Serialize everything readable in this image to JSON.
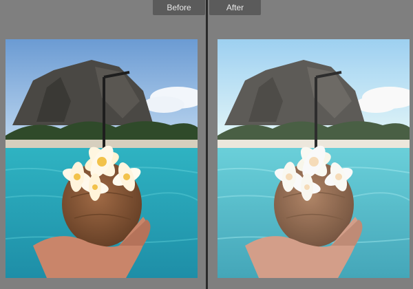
{
  "app": {
    "mode": "before-after-compare"
  },
  "panes": {
    "before": {
      "label": "Before"
    },
    "after": {
      "label": "After"
    }
  },
  "photo": {
    "subject": "hand-holding-coconut-with-frangipani-flowers",
    "colors": {
      "sky_top": "#6f9fd6",
      "sky_bottom": "#b8d4ef",
      "mountain": "#4a4a45",
      "palms": "#2f4a2a",
      "sand": "#d8d0c0",
      "water": "#2aa7b9",
      "coconut": "#8a5a3a",
      "skin": "#c88566",
      "flower": "#fff3d0",
      "flower_center": "#f3c64a"
    }
  }
}
